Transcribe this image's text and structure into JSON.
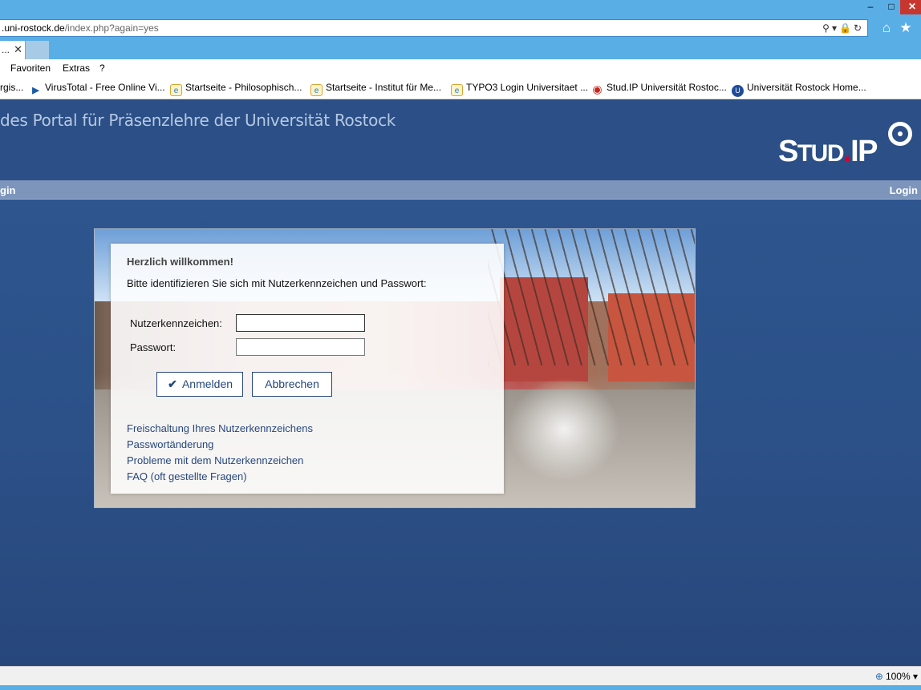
{
  "browser": {
    "address": {
      "host": ".uni-rostock.de",
      "path": "/index.php?again=yes"
    },
    "tab": {
      "label": "...",
      "close": "✕"
    },
    "menu": [
      "Favoriten",
      "Extras",
      "?"
    ],
    "favorites": [
      {
        "label": "rgis...",
        "icon": "ie-page-icon"
      },
      {
        "label": "VirusTotal - Free Online Vi...",
        "icon": "virustotal-icon"
      },
      {
        "label": "Startseite - Philosophisch...",
        "icon": "ie-page-icon"
      },
      {
        "label": "Startseite - Institut für Me...",
        "icon": "ie-page-icon"
      },
      {
        "label": "TYPO3 Login Universitaet ...",
        "icon": "ie-page-icon"
      },
      {
        "label": "Stud.IP Universität Rostoc...",
        "icon": "studip-icon"
      },
      {
        "label": "Universität Rostock Home...",
        "icon": "uni-rostock-icon"
      }
    ],
    "zoom": "100%"
  },
  "header": {
    "title": "des Portal für Präsenzlehre der Universität Rostock",
    "logo": {
      "part1": "S",
      "part2": "TUD",
      "dot": ".",
      "part3": "IP"
    }
  },
  "nav": {
    "left": "gin",
    "right": "Login"
  },
  "login": {
    "welcome": "Herzlich willkommen!",
    "instruction": "Bitte identifizieren Sie sich mit Nutzerkennzeichen und Passwort:",
    "username_label": "Nutzerkennzeichen:",
    "password_label": "Passwort:",
    "username_value": "",
    "password_value": "",
    "login_button": "Anmelden",
    "cancel_button": "Abbrechen",
    "links": [
      "Freischaltung Ihres Nutzerkennzeichens",
      "Passwortänderung",
      "Probleme mit dem Nutzerkennzeichen",
      "FAQ (oft gestellte Fragen)"
    ]
  },
  "colors": {
    "page_background": "#2b4f86",
    "nav_strip": "#7d95bb",
    "button_border": "#27477b",
    "link": "#27477b",
    "chrome": "#5aaee6"
  }
}
